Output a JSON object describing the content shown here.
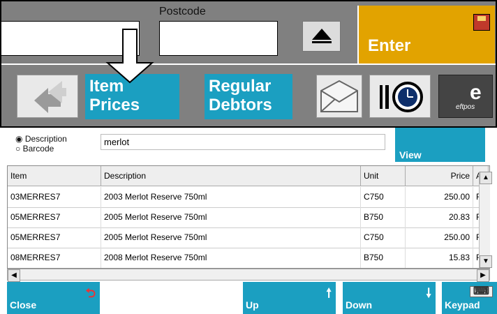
{
  "header": {
    "postcode_label": "Postcode",
    "enter_label": "Enter"
  },
  "toolbar": {
    "item_prices_line1": "Item",
    "item_prices_line2": "Prices",
    "regular_debtors_line1": "Regular",
    "regular_debtors_line2": "Debtors",
    "eftpos_label": "eftpos"
  },
  "search": {
    "radio_description": "Description",
    "radio_barcode": "Barcode",
    "query": "merlot",
    "view_label": "View"
  },
  "table": {
    "columns": [
      "Item",
      "Description",
      "Unit",
      "Price",
      "Ali"
    ],
    "rows": [
      {
        "item": "03MERRES7",
        "description": "2003 Merlot Reserve 750ml",
        "unit": "C750",
        "price": "250.00",
        "alias": "RE"
      },
      {
        "item": "05MERRES7",
        "description": "2005 Merlot Reserve 750ml",
        "unit": "B750",
        "price": "20.83",
        "alias": "RE"
      },
      {
        "item": "05MERRES7",
        "description": "2005 Merlot Reserve 750ml",
        "unit": "C750",
        "price": "250.00",
        "alias": "RE"
      },
      {
        "item": "08MERRES7",
        "description": "2008 Merlot Reserve 750ml",
        "unit": "B750",
        "price": "15.83",
        "alias": "RE"
      }
    ]
  },
  "footer": {
    "close_label": "Close",
    "up_label": "Up",
    "down_label": "Down",
    "keypad_label": "Keypad"
  },
  "colors": {
    "accent": "#1b9fc1",
    "enter": "#e2a300",
    "toolbar_bg": "#808080"
  }
}
